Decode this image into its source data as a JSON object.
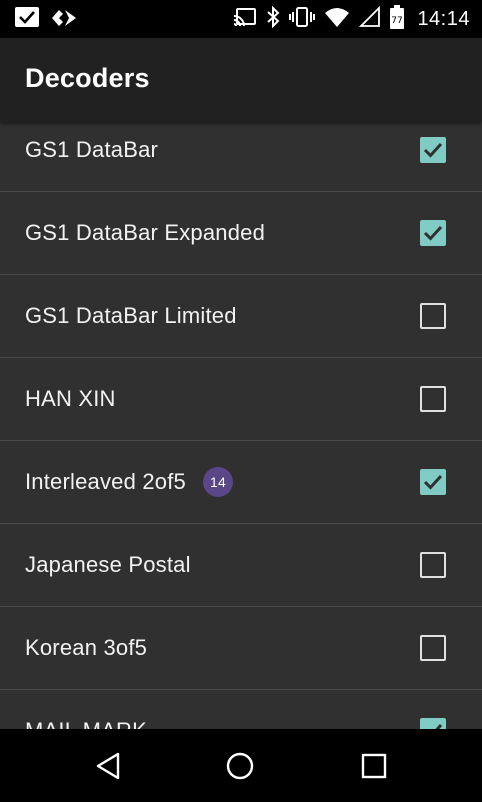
{
  "status_bar": {
    "time": "14:14",
    "left_icons": [
      "checkbox-notification-icon",
      "diamond-app-icon"
    ],
    "right_icons": [
      "cast-icon",
      "bluetooth-icon",
      "vibrate-icon",
      "wifi-icon",
      "cellular-icon",
      "battery-icon"
    ]
  },
  "app_bar": {
    "title": "Decoders"
  },
  "decoders": [
    {
      "label": "GS1 DataBar",
      "checked": true
    },
    {
      "label": "GS1 DataBar Expanded",
      "checked": true
    },
    {
      "label": "GS1 DataBar Limited",
      "checked": false
    },
    {
      "label": "HAN XIN",
      "checked": false
    },
    {
      "label": "Interleaved 2of5",
      "checked": true,
      "badge": "14"
    },
    {
      "label": "Japanese Postal",
      "checked": false
    },
    {
      "label": "Korean 3of5",
      "checked": false
    },
    {
      "label": "MAIL MARK",
      "checked": true
    }
  ],
  "nav_bar": {
    "back": "back-icon",
    "home": "home-icon",
    "recents": "recents-icon"
  },
  "colors": {
    "background": "#303030",
    "app_bar": "#212121",
    "checkbox_accent": "#80cbc4",
    "badge": "#5b4688",
    "divider": "#4a4a4a"
  }
}
